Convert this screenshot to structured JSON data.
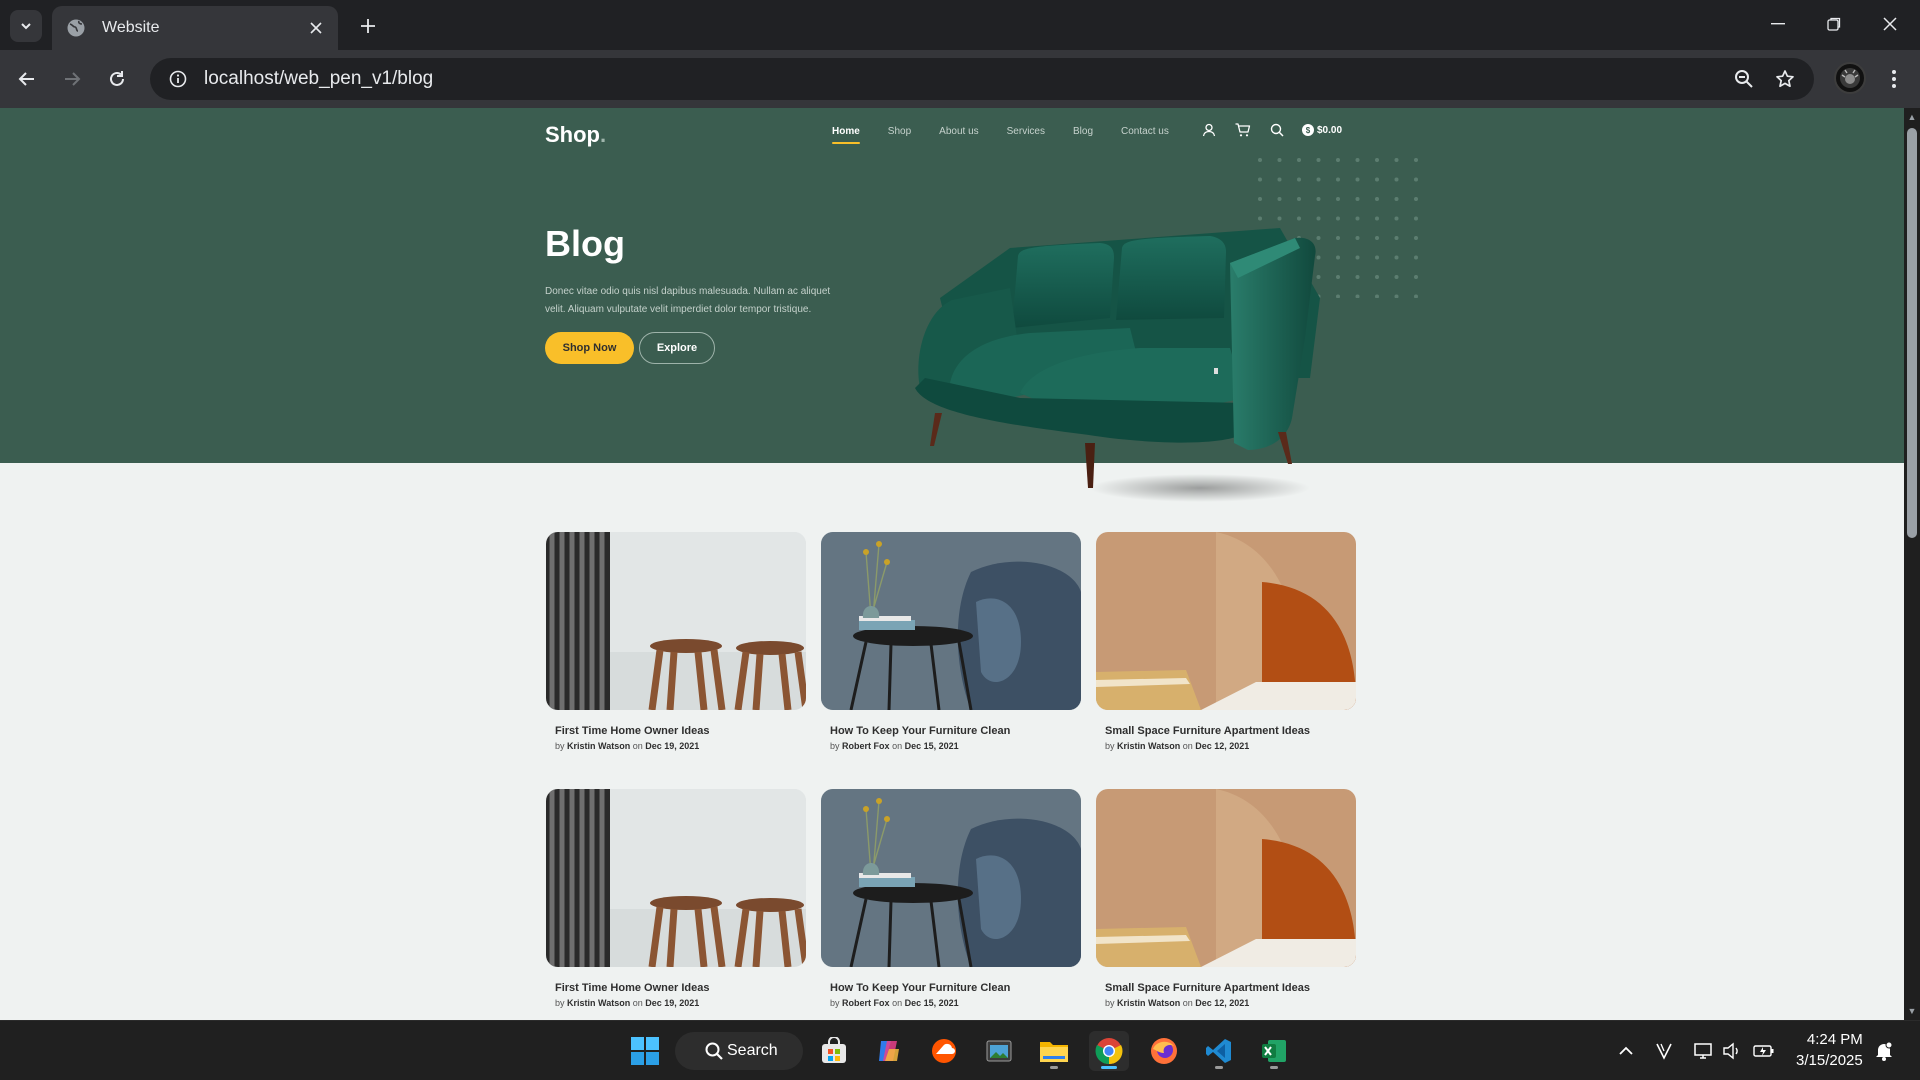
{
  "browser": {
    "tab_title": "Website",
    "url": "localhost/web_pen_v1/blog"
  },
  "site": {
    "logo": "Shop",
    "logo_dot": ".",
    "nav": [
      "Home",
      "Shop",
      "About us",
      "Services",
      "Blog",
      "Contact us"
    ],
    "active_nav": "Home",
    "cart_total": "$0.00",
    "coin_symbol": "$"
  },
  "hero": {
    "title": "Blog",
    "text": "Donec vitae odio quis nisl dapibus malesuada. Nullam ac aliquet velit. Aliquam vulputate velit imperdiet dolor tempor tristique.",
    "primary_button": "Shop Now",
    "secondary_button": "Explore"
  },
  "posts": [
    {
      "title": "First Time Home Owner Ideas",
      "by": "by",
      "author": "Kristin Watson",
      "on": "on",
      "date": "Dec 19, 2021",
      "image": "stools"
    },
    {
      "title": "How To Keep Your Furniture Clean",
      "by": "by",
      "author": "Robert Fox",
      "on": "on",
      "date": "Dec 15, 2021",
      "image": "side-table"
    },
    {
      "title": "Small Space Furniture Apartment Ideas",
      "by": "by",
      "author": "Kristin Watson",
      "on": "on",
      "date": "Dec 12, 2021",
      "image": "arches"
    },
    {
      "title": "First Time Home Owner Ideas",
      "by": "by",
      "author": "Kristin Watson",
      "on": "on",
      "date": "Dec 19, 2021",
      "image": "stools"
    },
    {
      "title": "How To Keep Your Furniture Clean",
      "by": "by",
      "author": "Robert Fox",
      "on": "on",
      "date": "Dec 15, 2021",
      "image": "side-table"
    },
    {
      "title": "Small Space Furniture Apartment Ideas",
      "by": "by",
      "author": "Kristin Watson",
      "on": "on",
      "date": "Dec 12, 2021",
      "image": "arches"
    }
  ],
  "taskbar": {
    "search_label": "Search",
    "time": "4:24 PM",
    "date": "3/15/2025"
  },
  "colors": {
    "hero_bg": "#3b5d50",
    "accent_yellow": "#f9bf29",
    "page_bg": "#eff2f1"
  }
}
